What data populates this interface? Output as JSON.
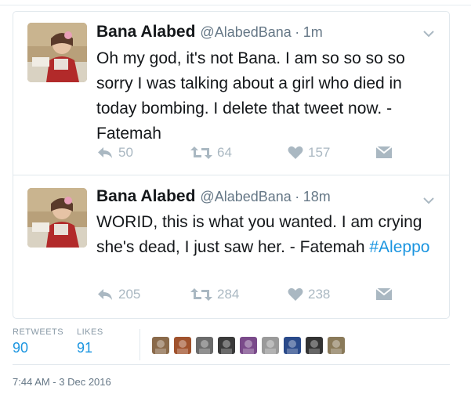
{
  "tweets": [
    {
      "name": "Bana Alabed",
      "handle": "@AlabedBana",
      "separator": "·",
      "time": "1m",
      "text": "Oh my god, it's not Bana. I am so so so so sorry I was talking about a girl who died in today bombing. I delete that tweet now. - Fatemah",
      "replies": "50",
      "retweets": "64",
      "likes": "157",
      "icons": [
        "reply-icon",
        "retweet-icon",
        "heart-icon",
        "direct-message-icon",
        "chevron-down-icon"
      ]
    },
    {
      "name": "Bana Alabed",
      "handle": "@AlabedBana",
      "separator": "·",
      "time": "18m",
      "text_main": "WORID, this is what you wanted. I am crying she's dead, I just saw her. - Fatemah ",
      "hashtag": "#Aleppo",
      "replies": "205",
      "retweets": "284",
      "likes": "238",
      "icons": [
        "reply-icon",
        "retweet-icon",
        "heart-icon",
        "direct-message-icon",
        "chevron-down-icon"
      ]
    }
  ],
  "stats": {
    "retweets_label": "RETWEETS",
    "retweets_value": "90",
    "likes_label": "LIKES",
    "likes_value": "91",
    "liker_avatar_colors": [
      "#8a6a4a",
      "#a0522d",
      "#6b6b6b",
      "#3a3a3a",
      "#7a4a8a",
      "#9a9a9a",
      "#2a4a8a",
      "#333333",
      "#8a7a5a"
    ]
  },
  "timestamp": "7:44 AM - 3 Dec 2016",
  "colors": {
    "link": "#1b95e0",
    "secondary_text": "#657786",
    "action_icon": "#aab8c2",
    "border": "#e1e8ed"
  }
}
